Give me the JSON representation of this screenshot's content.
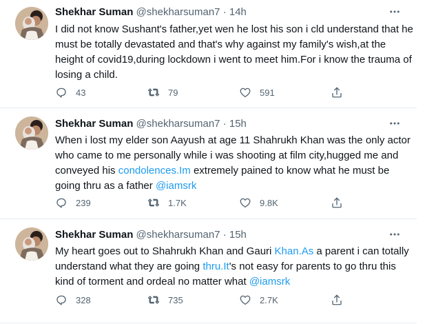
{
  "tweets": [
    {
      "name": "Shekhar Suman",
      "handle": "@shekharsuman7",
      "separator": "·",
      "time": "14h",
      "text_parts": [
        {
          "t": "I did not know Sushant's father,yet wen he lost his son i cld understand that he must be totally devastated and that's why against my family's wish,at the height of covid19,during lockdown i went to meet him.For i know the trauma of losing a child.",
          "link": false
        }
      ],
      "replies": "43",
      "retweets": "79",
      "likes": "591"
    },
    {
      "name": "Shekhar Suman",
      "handle": "@shekharsuman7",
      "separator": "·",
      "time": "15h",
      "text_parts": [
        {
          "t": "When i lost my elder son Aayush at age 11 Shahrukh Khan was the only actor who came to me personally while i was shooting at film city,hugged me and conveyed his ",
          "link": false
        },
        {
          "t": "condolences.Im",
          "link": true
        },
        {
          "t": " extremely pained to know what he must be going thru as a father ",
          "link": false
        },
        {
          "t": "@iamsrk",
          "link": true
        }
      ],
      "replies": "239",
      "retweets": "1.7K",
      "likes": "9.8K"
    },
    {
      "name": "Shekhar Suman",
      "handle": "@shekharsuman7",
      "separator": "·",
      "time": "15h",
      "text_parts": [
        {
          "t": "My heart goes out to Shahrukh Khan and Gauri ",
          "link": false
        },
        {
          "t": "Khan.As",
          "link": true
        },
        {
          "t": " a parent i can totally understand what they are going ",
          "link": false
        },
        {
          "t": "thru.It",
          "link": true
        },
        {
          "t": "'s not easy for parents to go thru this kind of torment and ordeal no matter what ",
          "link": false
        },
        {
          "t": "@iamsrk",
          "link": true
        }
      ],
      "replies": "328",
      "retweets": "735",
      "likes": "2.7K"
    }
  ],
  "icons": {
    "reply": "reply-icon",
    "retweet": "retweet-icon",
    "like": "like-icon",
    "share": "share-icon",
    "more": "more-icon"
  },
  "colors": {
    "text": "#0f1419",
    "secondary": "#536471",
    "link": "#1d9bf0",
    "divider": "#e6ecf0"
  }
}
